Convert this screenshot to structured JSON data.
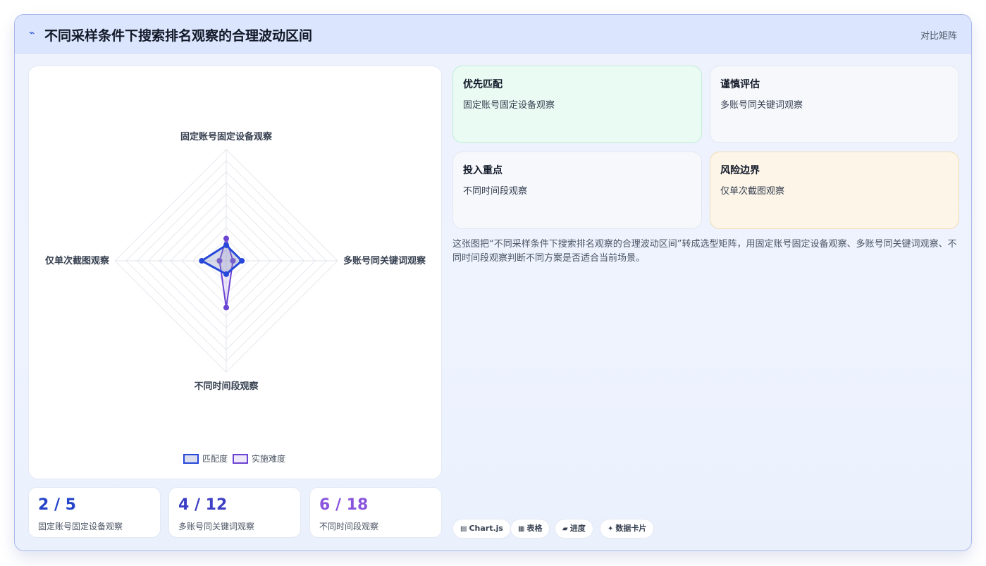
{
  "header": {
    "logo_icon": "⌁",
    "title": "不同采样条件下搜索排名观察的合理波动区间",
    "mode_label": "对比矩阵"
  },
  "chart_data": {
    "type": "radar",
    "axes": [
      "固定账号固定设备观察",
      "多账号同关键词观察",
      "不同时间段观察",
      "仅单次截图观察"
    ],
    "rmax": 5,
    "rings": 10,
    "series": [
      {
        "name": "匹配度",
        "values": [
          0.7,
          0.7,
          0.6,
          1.1
        ],
        "color": "#2748d8",
        "fill": "rgba(140,150,190,0.35)"
      },
      {
        "name": "实施难度",
        "values": [
          1.0,
          0.3,
          2.1,
          0.3
        ],
        "color": "#6c44d4",
        "fill": "rgba(160,130,220,0.18)"
      }
    ]
  },
  "stats": [
    {
      "value": "2 / 5",
      "label": "固定账号固定设备观察",
      "color": "#2443c9"
    },
    {
      "value": "4 / 12",
      "label": "多账号同关键词观察",
      "color": "#3d3fc4"
    },
    {
      "value": "6 / 18",
      "label": "不同时间段观察",
      "color": "#8a55dc"
    }
  ],
  "cards": [
    {
      "title": "优先匹配",
      "text": "固定账号固定设备观察"
    },
    {
      "title": "谨慎评估",
      "text": "多账号同关键词观察"
    },
    {
      "title": "投入重点",
      "text": "不同时间段观察"
    },
    {
      "title": "风险边界",
      "text": "仅单次截图观察"
    }
  ],
  "description": "这张图把“不同采样条件下搜索排名观察的合理波动区间”转成选型矩阵，用固定账号固定设备观察、多账号同关键词观察、不同时间段观察判断不同方案是否适合当前场景。",
  "tags": [
    {
      "icon": "▤",
      "label": "Chart.js"
    },
    {
      "icon": "▦",
      "label": "表格"
    },
    {
      "icon": "▰",
      "label": "进度"
    },
    {
      "icon": "✦",
      "label": "数据卡片"
    }
  ]
}
